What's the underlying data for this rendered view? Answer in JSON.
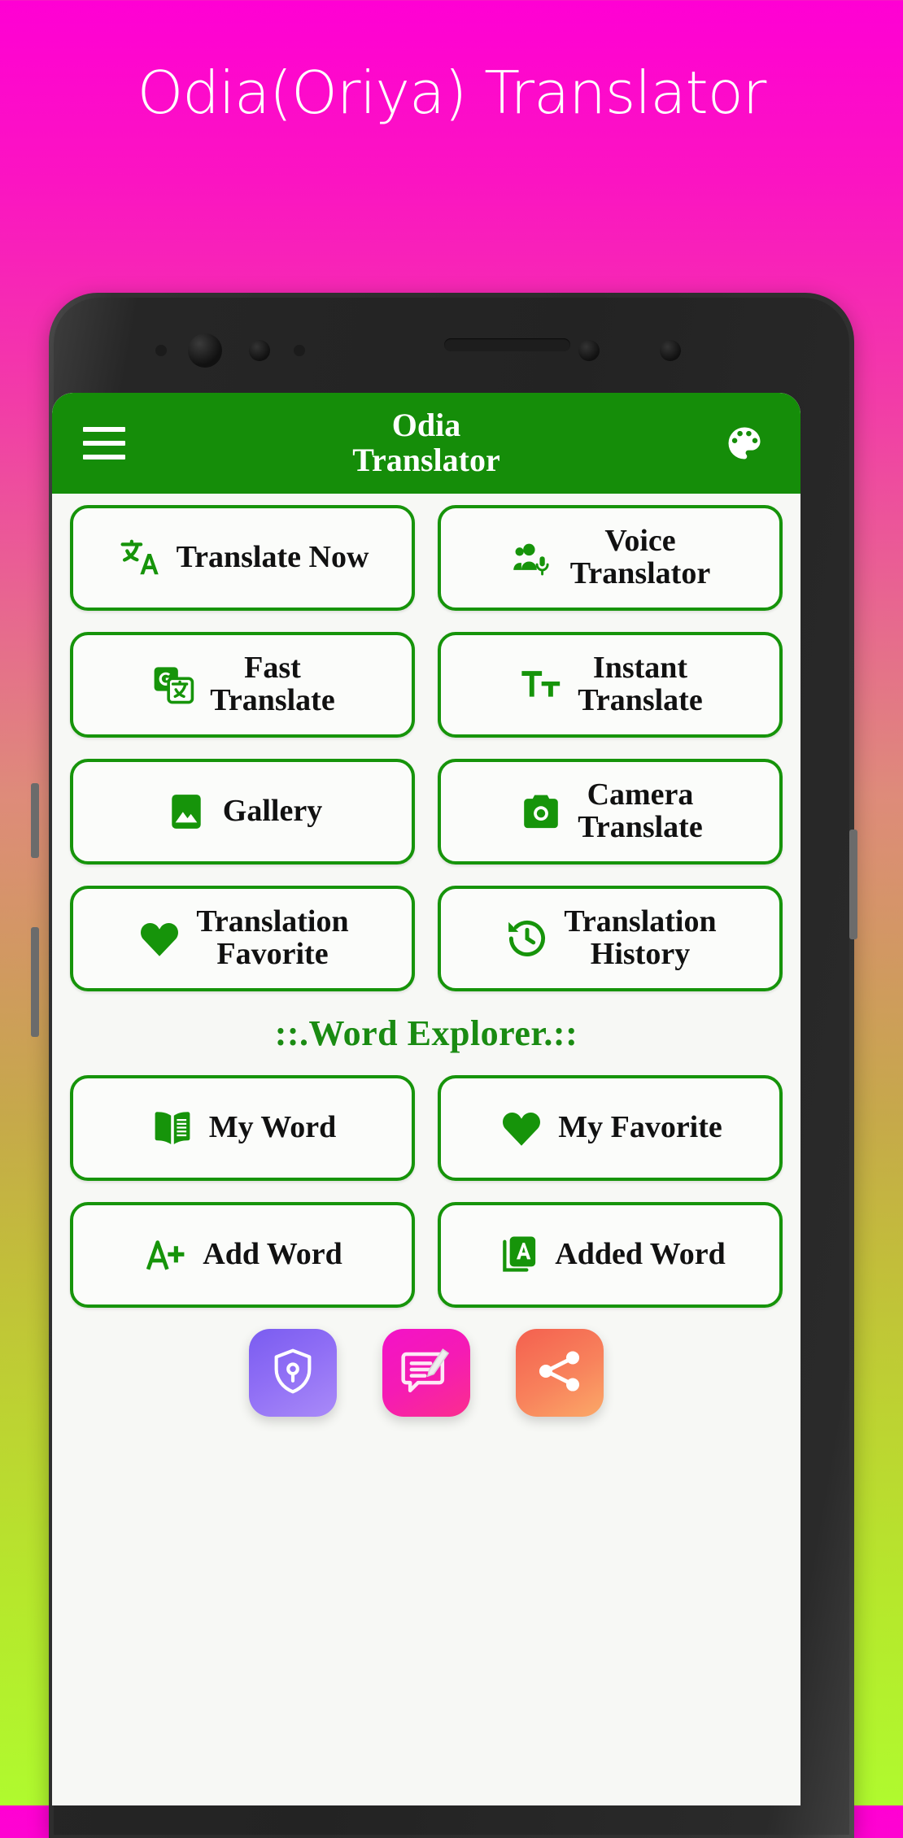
{
  "hero": {
    "title": "Odia(Oriya) Translator"
  },
  "appbar": {
    "menu_icon": "hamburger-menu-icon",
    "title_line1": "Odia",
    "title_line2": "Translator",
    "theme_icon": "palette-icon",
    "background_color": "#158D09"
  },
  "theme": {
    "green": "#16940a",
    "green_dark": "#158D09",
    "screen_bg": "#f7f8f5",
    "label_color": "#111111",
    "section_color": "#1a8b12"
  },
  "main": {
    "rows": [
      [
        {
          "label": "Translate Now",
          "icon": "translate-icon",
          "name": "translate-now-button"
        },
        {
          "label": "Voice\nTranslator",
          "line1": "Voice",
          "line2": "Translator",
          "icon": "voice-translator-icon",
          "name": "voice-translator-button"
        }
      ],
      [
        {
          "label": "Fast\nTranslate",
          "line1": "Fast",
          "line2": "Translate",
          "icon": "google-translate-icon",
          "name": "fast-translate-button"
        },
        {
          "label": "Instant\nTranslate",
          "line1": "Instant",
          "line2": "Translate",
          "icon": "text-format-icon",
          "name": "instant-translate-button"
        }
      ],
      [
        {
          "label": "Gallery",
          "icon": "image-gallery-icon",
          "name": "gallery-button"
        },
        {
          "label": "Camera\nTranslate",
          "line1": "Camera",
          "line2": "Translate",
          "icon": "camera-icon",
          "name": "camera-translate-button"
        }
      ],
      [
        {
          "label": "Translation\nFavorite",
          "line1": "Translation",
          "line2": "Favorite",
          "icon": "heart-icon",
          "name": "translation-favorite-button"
        },
        {
          "label": "Translation\nHistory",
          "line1": "Translation",
          "line2": "History",
          "icon": "history-clock-icon",
          "name": "translation-history-button"
        }
      ]
    ],
    "section_title": "::.Word Explorer.::",
    "word_rows": [
      [
        {
          "label": "My Word",
          "icon": "open-book-icon",
          "name": "my-word-button"
        },
        {
          "label": "My Favorite",
          "icon": "heart-icon",
          "name": "my-favorite-button"
        }
      ],
      [
        {
          "label": "Add Word",
          "icon": "a-plus-icon",
          "name": "add-word-button"
        },
        {
          "label": "Added Word",
          "icon": "added-word-card-icon",
          "name": "added-word-button"
        }
      ]
    ],
    "bottom_tiles": [
      {
        "icon": "shield-lock-icon",
        "name": "privacy-policy-tile",
        "color": "#8f6ef5"
      },
      {
        "icon": "chat-edit-icon",
        "name": "feedback-tile",
        "color": "#f51bb4"
      },
      {
        "icon": "share-icon",
        "name": "share-tile",
        "color": "#f8825c"
      }
    ]
  }
}
